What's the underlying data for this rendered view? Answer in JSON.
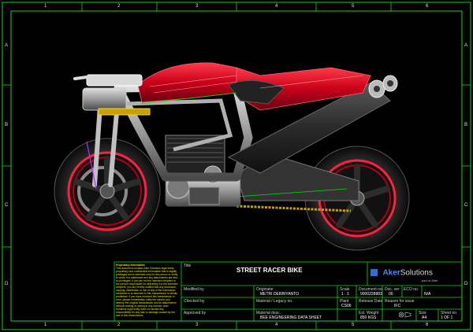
{
  "drawing": {
    "subject": "motorcycle-3d-render",
    "title_label": "Title",
    "title": "STREET RACER BIKE",
    "logo": {
      "brand_a": "Aker",
      "brand_b": "Solutions",
      "tag": "part of Aker"
    },
    "proprietary": {
      "heading": "Proprietary Information",
      "body": "This document contains Aker Solutions legal entity proprietary and confidential information that is legally privileged and is intended only for the person or entity to which it is addressed and any attachments are also so privileged. If you are not the intended recipient or the person responsible for delivering it to the intended recipient, you are hereby notified that any disclosure, copying, distribution or use of any of the information contained in or attached to this transmission is strictly prohibited. If you have received this transmission in error, please immediately notify the sender and destroy the original transmission and its attachments without reading or saving in any manner. Aker Solutions legal entity does not accept any responsibility for any loss or damage caused by the use of this transmission."
    },
    "fields": {
      "modified_by_label": "Modified by",
      "checked_by_label": "Checked by",
      "approved_by_label": "Approved by",
      "originator_label": "Originator",
      "originator": "METRI DERBIYANTO",
      "scale_label": "Scale",
      "scale": "1 : 1",
      "material_label": "Material / Legacy no.",
      "plant_label": "Plant",
      "plant": "CS06",
      "material_desc_label": "Material desc.",
      "material_desc": "BEE ENGINEERING DATA SHEET",
      "weight_label": "Est. Weight",
      "weight": "850 KGS",
      "document_label": "Document no.",
      "document": "9000228883",
      "doc_ver_label": "Doc. ver",
      "doc_ver": "00",
      "eco_label": "ECO no.",
      "eco": "N/A",
      "release_label": "Release Date",
      "reason_label": "Reason for issue",
      "reason": "IFC",
      "size_label": "Size",
      "size": "A4",
      "sheet_label": "Sheet no",
      "sheet": "1 OF 1"
    },
    "border": {
      "columns": [
        "1",
        "2",
        "3",
        "4",
        "5",
        "6"
      ],
      "rows": [
        "A",
        "B",
        "C",
        "D"
      ]
    },
    "colors": {
      "frame": "#00e000",
      "body_red": "#c8001a",
      "steel": "#9a9a9a",
      "gold": "#c8a000",
      "tire": "#2a2a2a"
    }
  }
}
